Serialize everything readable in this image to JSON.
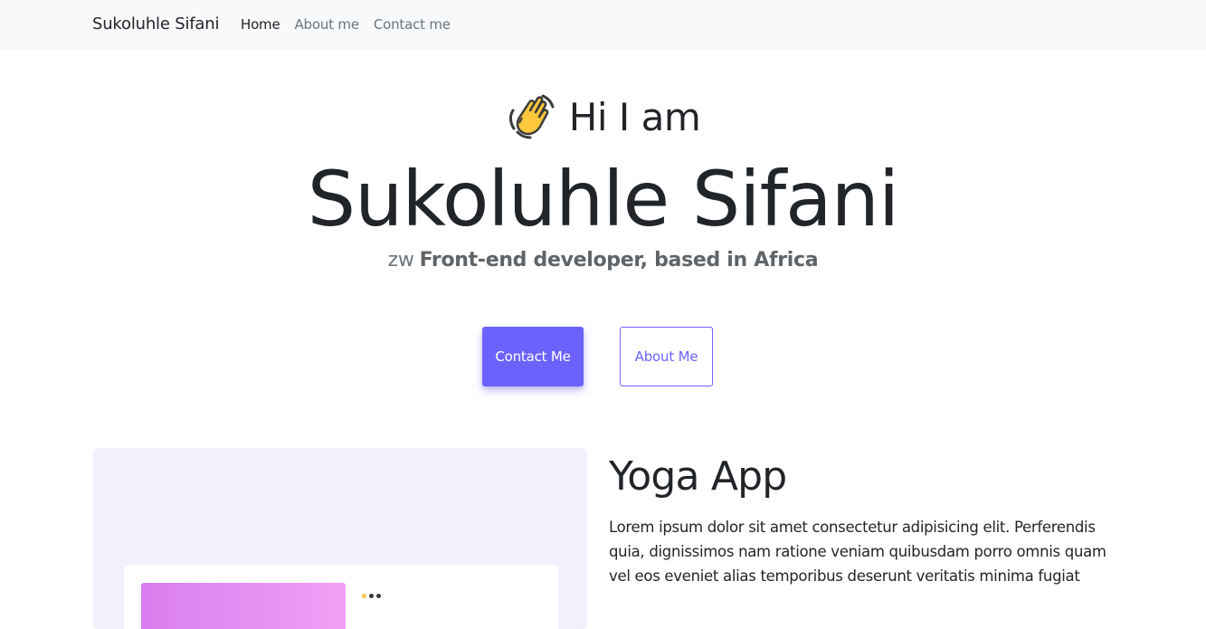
{
  "nav": {
    "brand": "Sukoluhle Sifani",
    "links": [
      {
        "label": "Home",
        "active": true
      },
      {
        "label": "About me",
        "active": false
      },
      {
        "label": "Contact me",
        "active": false
      }
    ]
  },
  "hero": {
    "wave_icon": "waving-hand-icon",
    "greeting": "Hi I am",
    "name": "Sukoluhle Sifani",
    "flag_text": "zw",
    "tagline": "Front-end developer, based in Africa"
  },
  "buttons": {
    "contact_label": "Contact Me",
    "about_label": "About Me"
  },
  "project": {
    "title": "Yoga App",
    "description": "Lorem ipsum dolor sit amet consectetur adipisicing elit. Perferendis quia, dignissimos nam ratione veniam quibusdam porro omnis quam vel eos eveniet alias temporibus deserunt veritatis minima fugiat"
  },
  "colors": {
    "accent": "#6c63ff",
    "navbar_bg": "#f8f9fa",
    "card_bg": "#f2f0fc",
    "text": "#212529",
    "muted": "#6c757d"
  }
}
